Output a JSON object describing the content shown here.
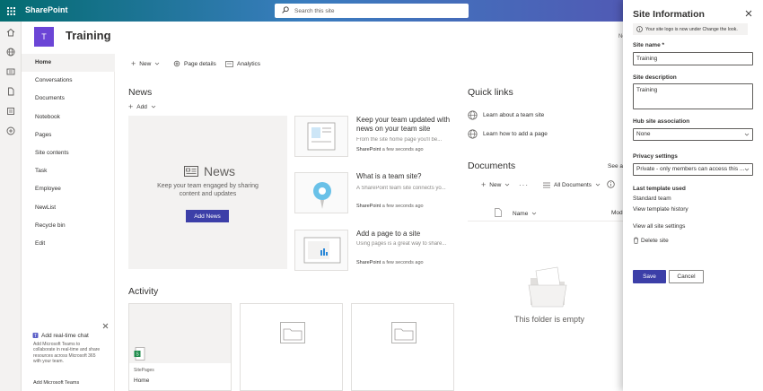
{
  "suite": {
    "brand": "SharePoint",
    "search_placeholder": "Search this site"
  },
  "site": {
    "logo_letter": "T",
    "title": "Training"
  },
  "nav": {
    "items": [
      "Home",
      "Conversations",
      "Documents",
      "Notebook",
      "Pages",
      "Site contents",
      "Task",
      "Employee",
      "NewList",
      "Recycle bin",
      "Edit"
    ]
  },
  "chat": {
    "title": "Add real-time chat",
    "text": "Add Microsoft Teams to collaborate in real-time and share resources across Microsoft 365 with your team.",
    "link": "Add Microsoft Teams"
  },
  "commands": {
    "new": "New",
    "page_details": "Page details",
    "analytics": "Analytics",
    "new_right": "Ne"
  },
  "news": {
    "title": "News",
    "add": "Add",
    "hero_title": "News",
    "hero_text": "Keep your team engaged by sharing content and updates",
    "hero_button": "Add News",
    "cards": [
      {
        "title": "Keep your team updated with news on your team site",
        "desc": "From the site home page you'll be...",
        "author": "SharePoint",
        "time": "a few seconds ago"
      },
      {
        "title": "What is a team site?",
        "desc": "A SharePoint team site connects yo...",
        "author": "SharePoint",
        "time": "a few seconds ago"
      },
      {
        "title": "Add a page to a site",
        "desc": "Using pages is a great way to share...",
        "author": "SharePoint",
        "time": "a few seconds ago"
      }
    ]
  },
  "quicklinks": {
    "title": "Quick links",
    "items": [
      "Learn about a team site",
      "Learn how to add a page"
    ]
  },
  "documents": {
    "title": "Documents",
    "see_all": "See al",
    "new": "New",
    "view": "All Documents",
    "col_name": "Name",
    "col_modified": "Mod",
    "empty": "This folder is empty"
  },
  "activity": {
    "title": "Activity",
    "card1_path": "SitePages",
    "card1_name": "Home"
  },
  "panel": {
    "title": "Site Information",
    "info": "Your site logo is now under Change the look.",
    "name_label": "Site name",
    "name_required": "*",
    "name_value": "Training",
    "desc_label": "Site description",
    "desc_value": "Training",
    "hub_label": "Hub site association",
    "hub_value": "None",
    "privacy_label": "Privacy settings",
    "privacy_value": "Private - only members can access this ...",
    "template_label": "Last template used",
    "template_value": "Standard team",
    "template_history": "View template history",
    "view_all": "View all site settings",
    "delete": "Delete site",
    "save": "Save",
    "cancel": "Cancel"
  },
  "colors": {
    "accent": "#3c3fa8",
    "logo": "#6b45d6",
    "suite_start": "#036c70",
    "suite_end": "#5a4bb0"
  },
  "icons": [
    "waffle-icon",
    "search-icon",
    "home-icon",
    "globe-icon",
    "news-icon",
    "file-icon",
    "list-icon",
    "plus-circle-icon",
    "teams-icon",
    "close-icon",
    "info-icon",
    "chevron-down-icon",
    "gear-icon",
    "chart-icon",
    "trash-icon",
    "document-icon",
    "folder-icon",
    "filter-icon",
    "ellipsis-icon",
    "link-globe-icon"
  ]
}
